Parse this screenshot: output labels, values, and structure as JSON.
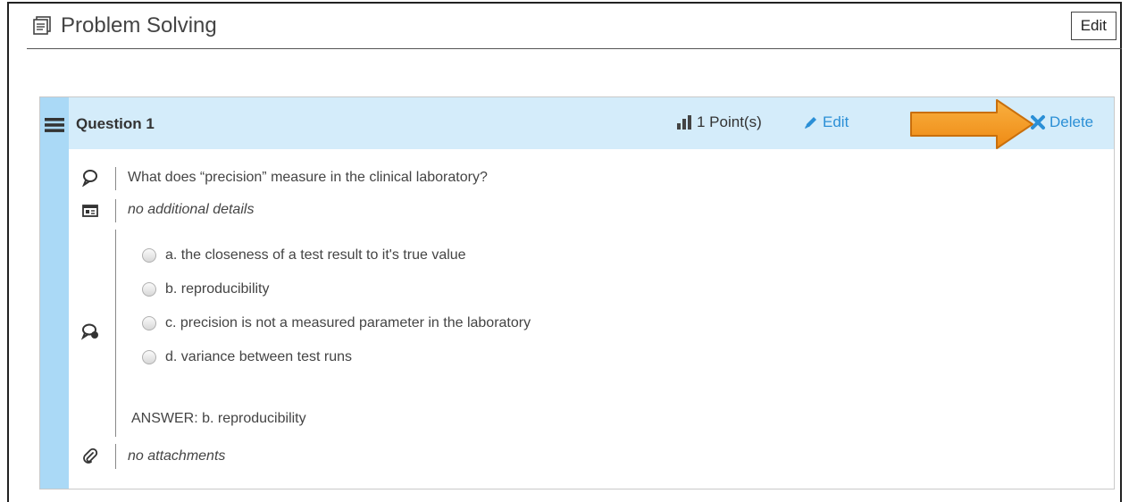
{
  "header": {
    "title": "Problem Solving",
    "edit_label": "Edit",
    "icon": "book-icon"
  },
  "question": {
    "title": "Question 1",
    "points": "1 Point(s)",
    "edit_label": "Edit",
    "delete_label": "Delete",
    "text": "What does “precision” measure in the clinical laboratory?",
    "details": "no additional details",
    "options": [
      "a. the closeness of a test result to it's true value",
      "b. reproducibility",
      "c. precision is not a measured parameter in the laboratory",
      "d. variance between test runs"
    ],
    "answer": "ANSWER: b. reproducibility",
    "attachments": "no attachments"
  },
  "colors": {
    "accent": "#2b8fd6",
    "header_bg": "#d4ecfa",
    "strip_bg": "#aad9f6",
    "arrow": "#f39a25"
  }
}
